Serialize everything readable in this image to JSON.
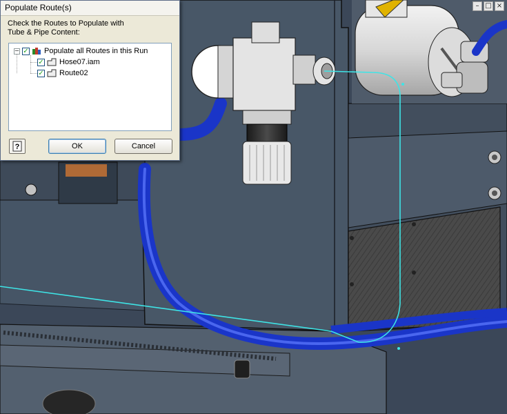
{
  "window_controls": [
    "–",
    "□",
    "×"
  ],
  "dialog": {
    "title": "Populate Route(s)",
    "instruction_line1": "Check the Routes to Populate with",
    "instruction_line2": "Tube & Pipe Content:",
    "tree": {
      "root": {
        "label": "Populate all Routes in this Run",
        "checked": true,
        "expander": "–"
      },
      "children": [
        {
          "label": "Hose07.iam",
          "checked": true
        },
        {
          "label": "Route02",
          "checked": true
        }
      ]
    },
    "help_label": "?",
    "ok_label": "OK",
    "cancel_label": "Cancel"
  },
  "colors": {
    "hose": "#1a35c8",
    "route_line": "#3ee4e6",
    "part_body": "#475566"
  },
  "icons": {
    "window_minimize": "minimize-icon",
    "window_restore": "restore-icon",
    "window_close": "close-icon",
    "help": "help-icon",
    "route": "route-icon",
    "run": "run-icon"
  }
}
